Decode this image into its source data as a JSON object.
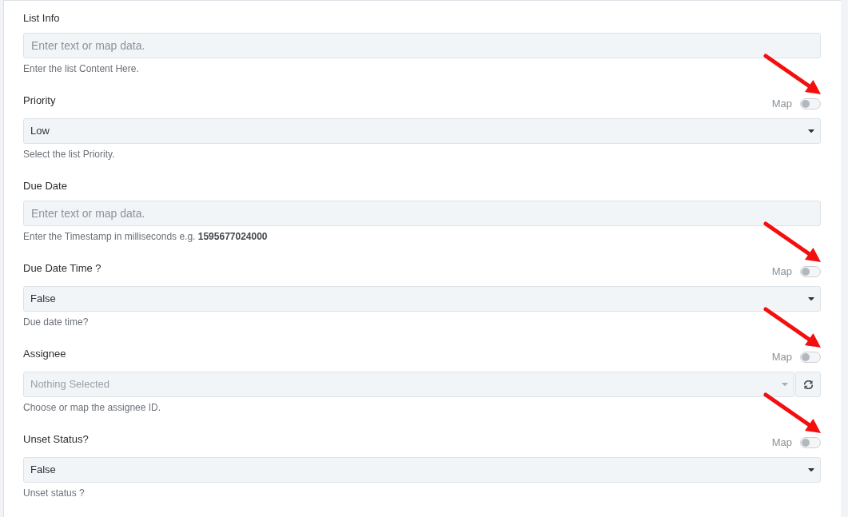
{
  "fields": [
    {
      "kind": "text",
      "label": "List Info",
      "placeholder": "Enter text or map data.",
      "help": "Enter the list Content Here."
    },
    {
      "kind": "select",
      "label": "Priority",
      "map_toggle": {
        "label": "Map",
        "on": false,
        "annotated": true
      },
      "value": "Low",
      "help": "Select the list Priority."
    },
    {
      "kind": "text",
      "label": "Due Date",
      "placeholder": "Enter text or map data.",
      "help": "Enter the Timestamp in milliseconds e.g. **1595677024000**"
    },
    {
      "kind": "select",
      "label": "Due Date Time ?",
      "map_toggle": {
        "label": "Map",
        "on": false,
        "annotated": true
      },
      "value": "False",
      "help": "Due date time?"
    },
    {
      "kind": "select",
      "label": "Assignee",
      "map_toggle": {
        "label": "Map",
        "on": false,
        "annotated": true
      },
      "placeholder": "Nothing Selected",
      "refresh_button": true,
      "help": "Choose or map the assignee ID."
    },
    {
      "kind": "select",
      "label": "Unset Status?",
      "map_toggle": {
        "label": "Map",
        "on": false,
        "annotated": true
      },
      "value": "False",
      "help": "Unset status ?"
    }
  ]
}
